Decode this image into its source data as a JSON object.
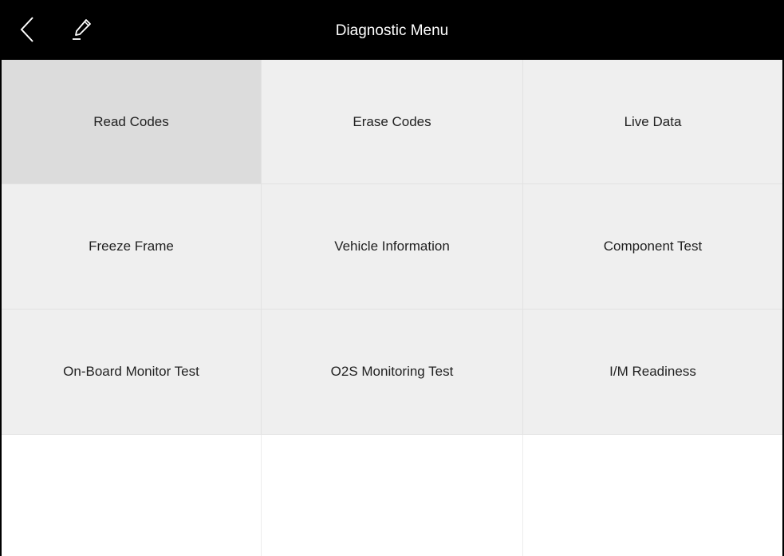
{
  "header": {
    "title": "Diagnostic Menu",
    "back_icon": "chevron-left-icon",
    "edit_icon": "pencil-icon"
  },
  "menu": {
    "items": [
      {
        "label": "Read Codes",
        "selected": true
      },
      {
        "label": "Erase Codes",
        "selected": false
      },
      {
        "label": "Live Data",
        "selected": false
      },
      {
        "label": "Freeze Frame",
        "selected": false
      },
      {
        "label": "Vehicle Information",
        "selected": false
      },
      {
        "label": "Component Test",
        "selected": false
      },
      {
        "label": "On-Board Monitor Test",
        "selected": false
      },
      {
        "label": "O2S Monitoring Test",
        "selected": false
      },
      {
        "label": "I/M Readiness",
        "selected": false
      }
    ]
  },
  "colors": {
    "header_bg": "#000000",
    "header_text": "#ffffff",
    "tile_bg": "#efefef",
    "tile_selected_bg": "#dcdcdc",
    "tile_text": "#222222"
  }
}
